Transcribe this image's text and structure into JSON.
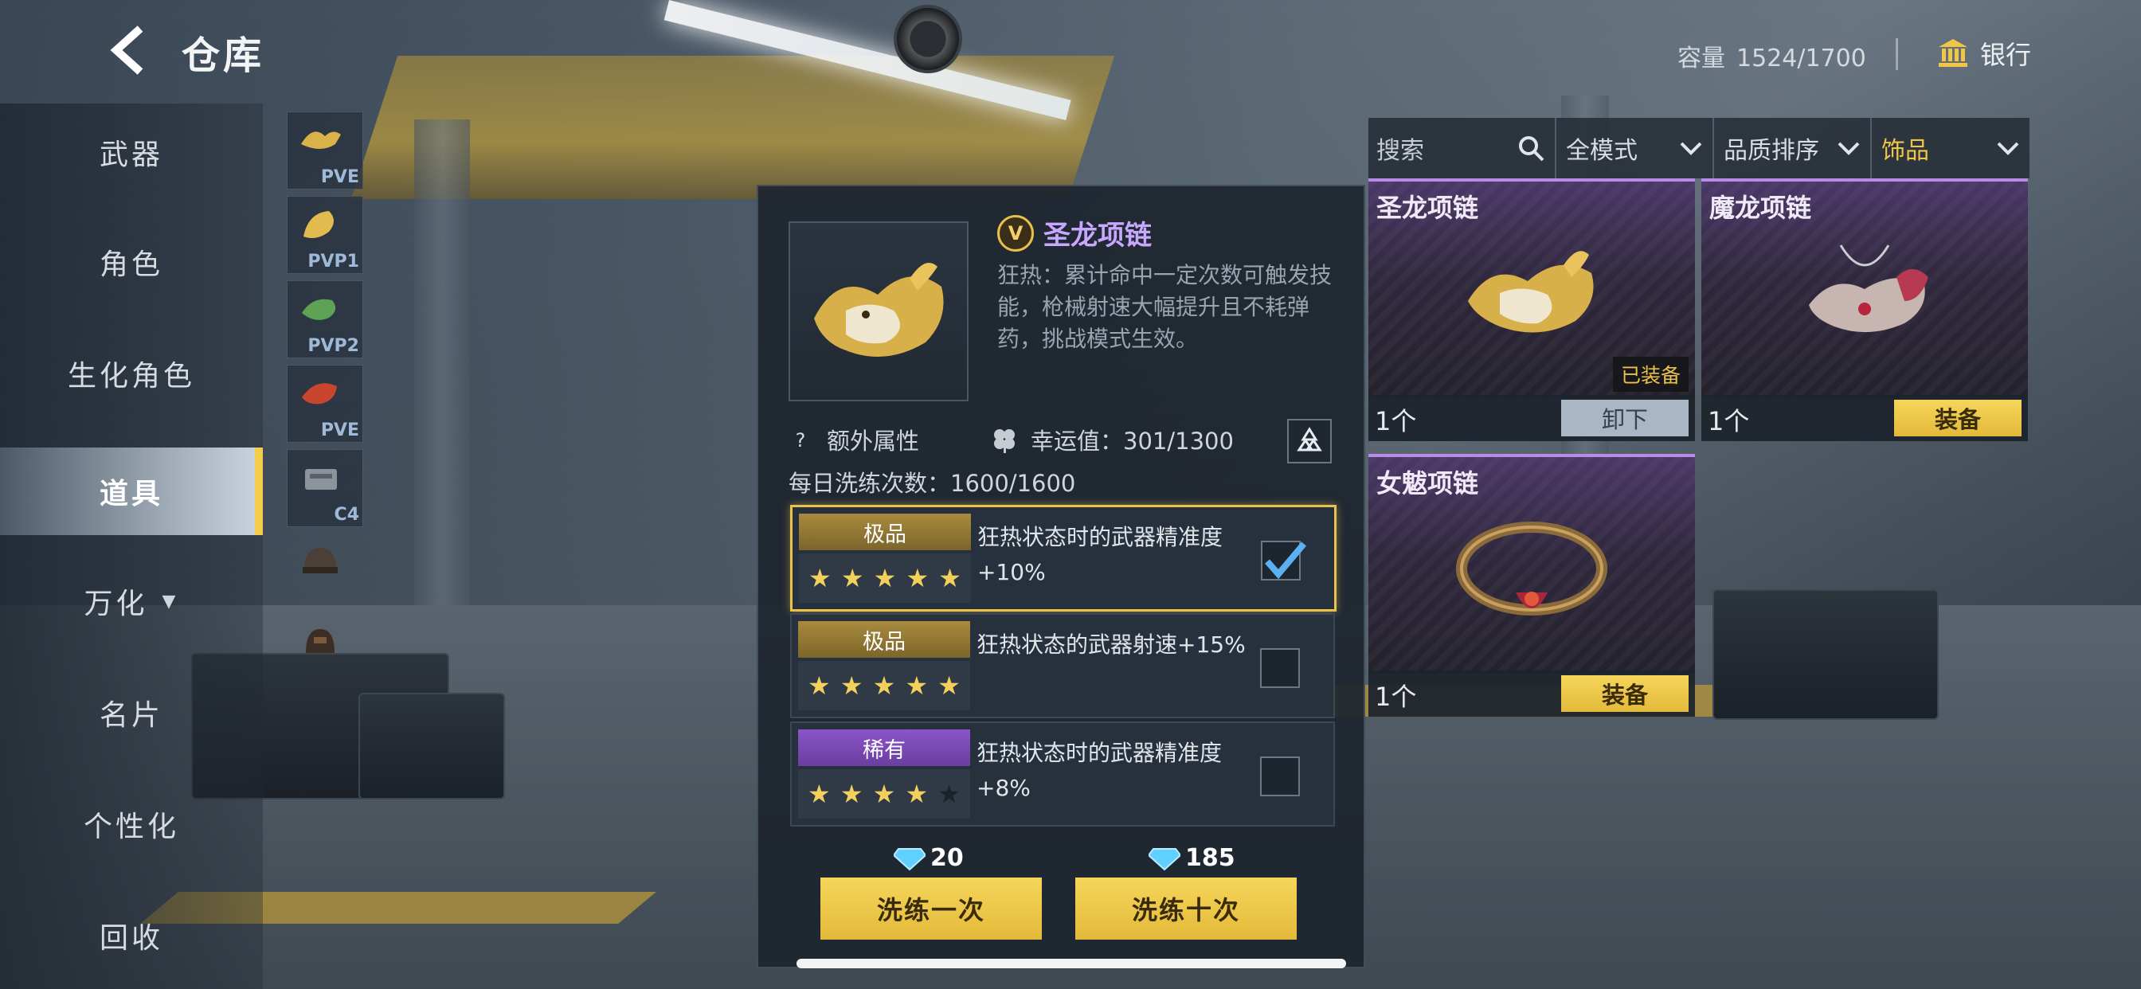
{
  "header": {
    "title": "仓库",
    "capacity_label": "容量",
    "capacity_value": "1524/1700",
    "bank_label": "银行"
  },
  "leftnav": {
    "items": [
      {
        "label": "武器"
      },
      {
        "label": "角色"
      },
      {
        "label": "生化角色"
      },
      {
        "label": "道具"
      },
      {
        "label": "万化"
      },
      {
        "label": "名片"
      },
      {
        "label": "个性化"
      },
      {
        "label": "回收"
      }
    ],
    "active": "道具"
  },
  "subnav": {
    "items": [
      {
        "tag": "PVE"
      },
      {
        "tag": "PVP1"
      },
      {
        "tag": "PVP2"
      },
      {
        "tag": "PVE"
      },
      {
        "tag": "C4"
      },
      {
        "tag": ""
      },
      {
        "tag": ""
      }
    ]
  },
  "detail": {
    "item_name": "圣龙项链",
    "badge_letter": "V",
    "description": "狂热：累计命中一定次数可触发技能，枪械射速大幅提升且不耗弹药，挑战模式生效。",
    "extra_attr_label": "额外属性",
    "luck_label": "幸运值：301/1300",
    "daily_wash_label": "每日洗练次数：1600/1600",
    "options": [
      {
        "grade": "极品",
        "grade_color": "#a98b3e",
        "stars": 5,
        "max_stars": 5,
        "text": "狂热状态时的武器精准度+10%",
        "checked": true
      },
      {
        "grade": "极品",
        "grade_color": "#a98b3e",
        "stars": 5,
        "max_stars": 5,
        "text": "狂热状态的武器射速+15%",
        "checked": false
      },
      {
        "grade": "稀有",
        "grade_color": "#8a55c9",
        "stars": 4,
        "max_stars": 5,
        "text": "狂热状态时的武器精准度+8%",
        "checked": false
      }
    ],
    "wash_once": {
      "label": "洗练一次",
      "cost": "20"
    },
    "wash_ten": {
      "label": "洗练十次",
      "cost": "185"
    }
  },
  "filters": {
    "search_placeholder": "搜索",
    "mode": "全模式",
    "sort": "品质排序",
    "category": "饰品",
    "accent_color": "#f1c545"
  },
  "inventory": [
    {
      "name": "圣龙项链",
      "count": "1个",
      "button": "卸下",
      "equipped_tag": "已装备"
    },
    {
      "name": "魔龙项链",
      "count": "1个",
      "button": "装备",
      "equipped_tag": ""
    },
    {
      "name": "女魃项链",
      "count": "1个",
      "button": "装备",
      "equipped_tag": ""
    }
  ]
}
